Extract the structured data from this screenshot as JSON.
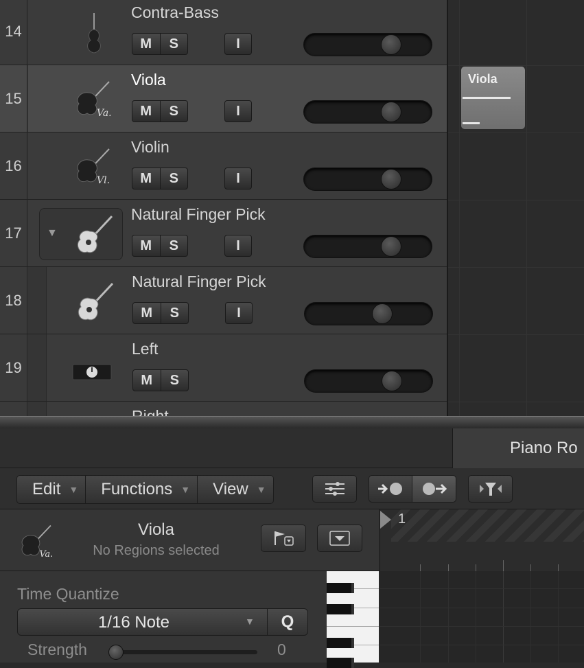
{
  "tracks": [
    {
      "number": "14",
      "name": "Contra-Bass",
      "mute": "M",
      "solo": "S",
      "input": "I",
      "volume": 0.72,
      "icon": "contrabass-icon"
    },
    {
      "number": "15",
      "name": "Viola",
      "mute": "M",
      "solo": "S",
      "input": "I",
      "volume": 0.72,
      "icon": "viola-icon",
      "selected": true
    },
    {
      "number": "16",
      "name": "Violin",
      "mute": "M",
      "solo": "S",
      "input": "I",
      "volume": 0.72,
      "icon": "violin-icon"
    },
    {
      "number": "17",
      "name": "Natural Finger Pick",
      "mute": "M",
      "solo": "S",
      "input": "I",
      "volume": 0.72,
      "icon": "acoustic-guitar-icon",
      "folder": true
    },
    {
      "number": "18",
      "name": "Natural Finger Pick",
      "mute": "M",
      "solo": "S",
      "input": "I",
      "volume": 0.63,
      "icon": "acoustic-guitar-icon"
    },
    {
      "number": "19",
      "name": "Left",
      "mute": "M",
      "solo": "S",
      "volume": 0.72,
      "icon": "pan-knob-icon"
    },
    {
      "number": "",
      "name": "Right"
    }
  ],
  "region": {
    "title": "Viola"
  },
  "editor": {
    "tab_label": "Piano Ro",
    "menus": [
      "Edit",
      "Functions",
      "View"
    ],
    "inspector": {
      "track_name": "Viola",
      "status": "No Regions selected",
      "time_quantize_label": "Time Quantize",
      "time_quantize_value": "1/16 Note",
      "quantize_button": "Q",
      "strength_label": "Strength",
      "strength_value": "0"
    },
    "ruler": {
      "bar_label": "1"
    }
  }
}
